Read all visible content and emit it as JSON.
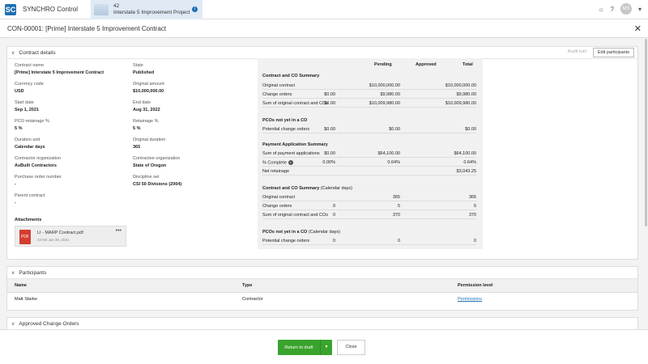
{
  "app": {
    "name": "SYNCHRO Control",
    "logo": "SC"
  },
  "project": {
    "number": "42",
    "name": "Interstate 5 Improvement Project"
  },
  "user": {
    "initials": "MS"
  },
  "page": {
    "title": "CON-00001: [Prime] Interstate 5 Improvement Contract"
  },
  "contract_details": {
    "heading": "Contract details",
    "audit_trail": "Audit trail",
    "edit_participants": "Edit participants",
    "fields": [
      {
        "label": "Contract name",
        "value": "[Prime] Interstate 5 Improvement Contract"
      },
      {
        "label": "Currency code",
        "value": "USD"
      },
      {
        "label": "Start date",
        "value": "Sep 1, 2021"
      },
      {
        "label": "PCO retainage %",
        "value": "5 %"
      },
      {
        "label": "Duration unit",
        "value": "Calendar days"
      },
      {
        "label": "Contractor organization",
        "value": "AsBuilt Contractors"
      },
      {
        "label": "Purchase order number",
        "value": "-"
      },
      {
        "label": "Parent contract",
        "value": "-"
      },
      {
        "label": "State",
        "value": "Published"
      },
      {
        "label": "Original amount",
        "value": "$10,000,000.00"
      },
      {
        "label": "End date",
        "value": "Aug 31, 2022"
      },
      {
        "label": "Retainage %",
        "value": "5 %"
      },
      {
        "label": "Original duration",
        "value": "365"
      },
      {
        "label": "Contractee organization",
        "value": "State of Oregon"
      },
      {
        "label": "Discipline set",
        "value": "CSI 50 Divisions (2004)"
      }
    ],
    "attachments": {
      "title": "Attachments",
      "file_name": "LI - MARP Contract.pdf",
      "file_meta": "34 KB Jun 30, 2021",
      "file_type": "PDF",
      "menu": "•••"
    }
  },
  "summary": {
    "columns": [
      "Pending",
      "Approved",
      "Total"
    ],
    "sections": [
      {
        "title": "Contract and CO Summary",
        "suffix": "",
        "rows": [
          {
            "label": "Original contract",
            "c1": "",
            "c2": "$10,000,000.00",
            "c3": "$10,000,000.00"
          },
          {
            "label": "Change orders",
            "c1": "$0.00",
            "c2": "$9,980.00",
            "c3": "$9,980.00"
          },
          {
            "label": "Sum of original contract and COs",
            "c1": "$0.00",
            "c2": "$10,009,980.00",
            "c3": "$10,009,980.00"
          }
        ]
      },
      {
        "title": "PCOs not yet in a CO",
        "suffix": "",
        "rows": [
          {
            "label": "Potential change orders",
            "c1": "$0.00",
            "c2": "$0.00",
            "c3": "$0.00"
          }
        ]
      },
      {
        "title": "Payment Application Summary",
        "suffix": "",
        "rows": [
          {
            "label": "Sum of payment applications",
            "c1": "$0.00",
            "c2": "$64,100.00",
            "c3": "$64,100.00"
          },
          {
            "label": "% Complete",
            "c1": "0.00%",
            "c2": "0.64%",
            "c3": "0.64%"
          },
          {
            "label": "Net retainage",
            "c1": "",
            "c2": "",
            "c3": "$3,043.25"
          }
        ]
      },
      {
        "title": "Contract and CO Summary",
        "suffix": "(Calendar days)",
        "rows": [
          {
            "label": "Original contract",
            "c1": "",
            "c2": "365",
            "c3": "365"
          },
          {
            "label": "Change orders",
            "c1": "0",
            "c2": "5",
            "c3": "5"
          },
          {
            "label": "Sum of original contract and COs",
            "c1": "0",
            "c2": "370",
            "c3": "370"
          }
        ]
      },
      {
        "title": "PCOs not yet in a CO",
        "suffix": "(Calendar days)",
        "rows": [
          {
            "label": "Potential change orders",
            "c1": "0",
            "c2": "0",
            "c3": "0"
          }
        ]
      }
    ]
  },
  "participants": {
    "heading": "Participants",
    "columns": [
      "Name",
      "Type",
      "Permission level"
    ],
    "rows": [
      {
        "name": "Matt Starke",
        "type": "Contractor",
        "permission": "Permissions"
      }
    ]
  },
  "approved_change_orders": {
    "heading": "Approved Change Orders"
  },
  "footer": {
    "return_to_draft": "Return to draft",
    "close": "Close"
  }
}
